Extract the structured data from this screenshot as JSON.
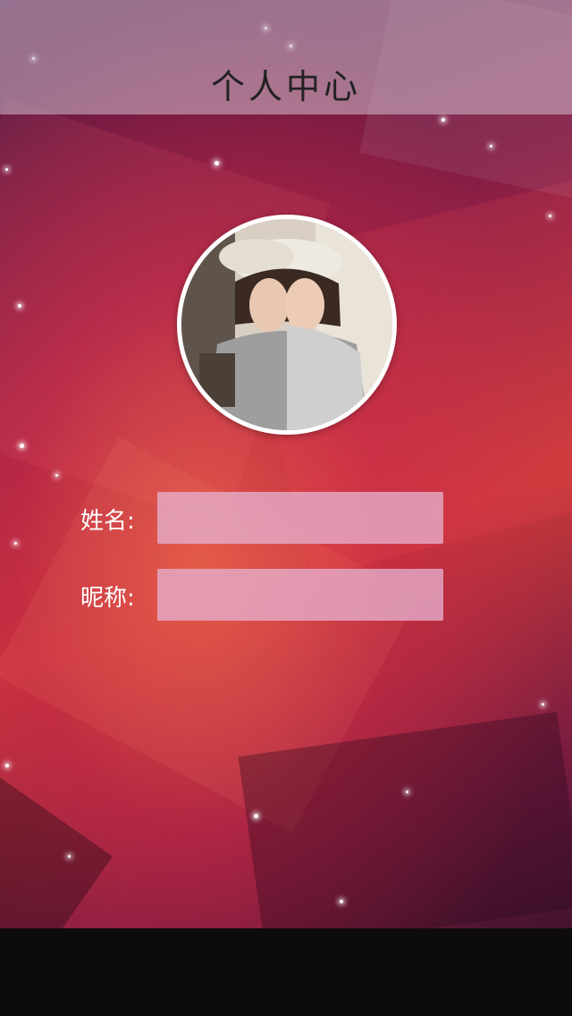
{
  "header": {
    "title": "个人中心"
  },
  "profile": {
    "avatar_icon": "user-photo"
  },
  "form": {
    "name_label": "姓名:",
    "name_value": "",
    "nickname_label": "昵称:",
    "nickname_value": ""
  }
}
